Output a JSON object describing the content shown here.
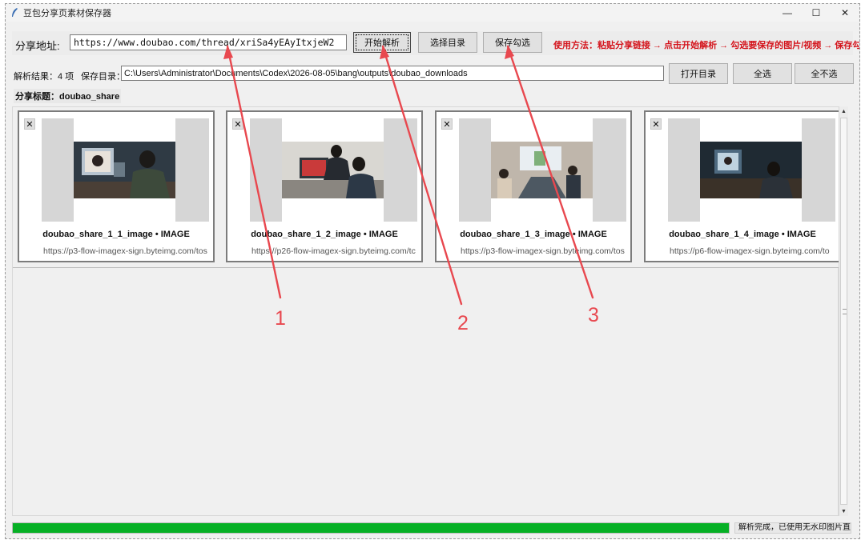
{
  "window": {
    "title": "豆包分享页素材保存器",
    "minimize": "—",
    "maximize": "☐",
    "close": "✕"
  },
  "toolbar": {
    "share_label": "分享地址:",
    "url_value": "https://www.doubao.com/thread/xriSa4yEAyItxjeW2",
    "parse_button": "开始解析",
    "choose_dir_button": "选择目录",
    "save_checked_button": "保存勾选",
    "usage_text": "使用方法：粘贴分享链接 → 点击开始解析 → 勾选要保存的图片/视频 → 保存勾选"
  },
  "row2": {
    "result_text": "解析结果：4 项",
    "save_dir_label": "保存目录：",
    "save_dir_value": "C:\\Users\\Administrator\\Documents\\Codex\\2026-08-05\\bang\\outputs\\doubao_downloads",
    "open_dir_button": "打开目录",
    "select_all_button": "全选",
    "select_none_button": "全不选"
  },
  "share_title": "分享标题：doubao_share",
  "cards": [
    {
      "checkbox": "✕",
      "name": "doubao_share_1_1_image  •  IMAGE",
      "url": "https://p3-flow-imagex-sign.byteimg.com/tos"
    },
    {
      "checkbox": "✕",
      "name": "doubao_share_1_2_image  •  IMAGE",
      "url": "https://p26-flow-imagex-sign.byteimg.com/tc"
    },
    {
      "checkbox": "✕",
      "name": "doubao_share_1_3_image  •  IMAGE",
      "url": "https://p3-flow-imagex-sign.byteimg.com/tos"
    },
    {
      "checkbox": "✕",
      "name": "doubao_share_1_4_image  •  IMAGE",
      "url": "https://p6-flow-imagex-sign.byteimg.com/to"
    }
  ],
  "status": {
    "progress": 1.0,
    "text": "解析完成，已使用无水印图片直链"
  },
  "annotations": [
    "1",
    "2",
    "3"
  ],
  "colors": {
    "accent_red": "#d4141c",
    "arrow_red": "#e8484f",
    "progress_green": "#06b025"
  }
}
